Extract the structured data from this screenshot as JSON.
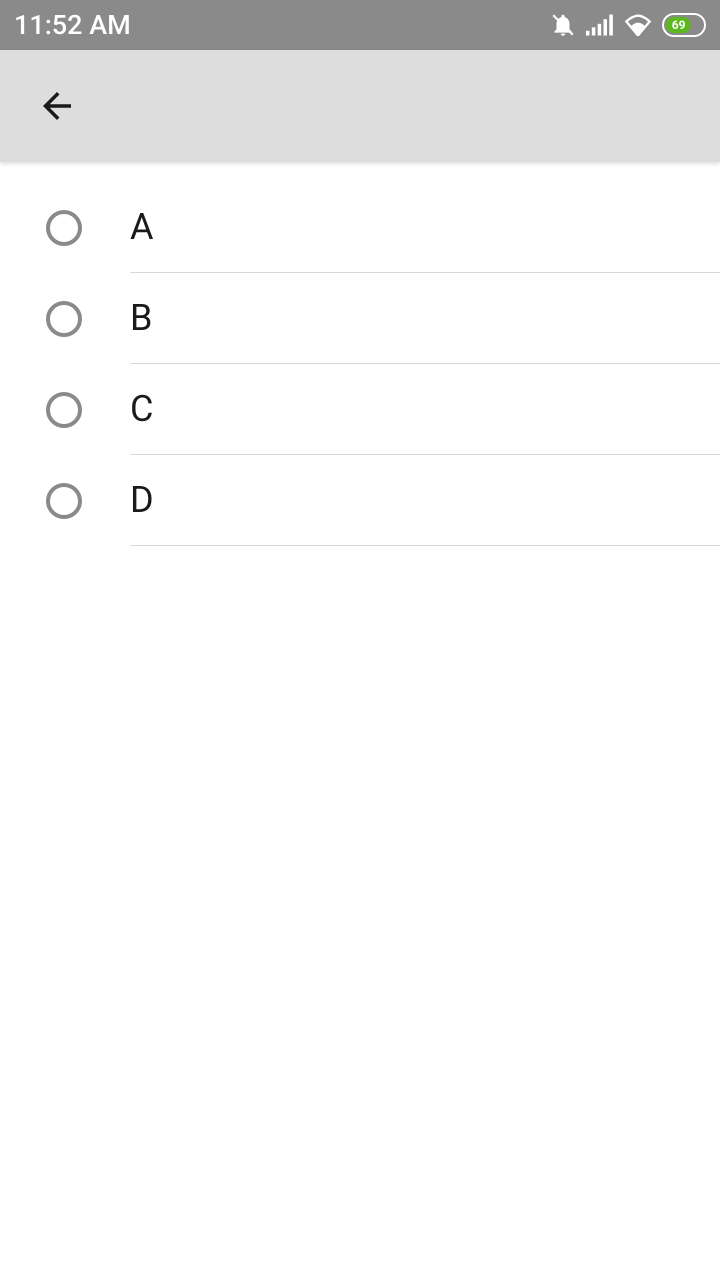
{
  "status_bar": {
    "time": "11:52 AM",
    "battery_level": "69",
    "icons": {
      "bell": "notifications-off-icon",
      "signal": "cellular-signal-icon",
      "wifi": "wifi-icon"
    }
  },
  "app_bar": {
    "back": "back"
  },
  "options": [
    {
      "label": "A",
      "selected": false
    },
    {
      "label": "B",
      "selected": false
    },
    {
      "label": "C",
      "selected": false
    },
    {
      "label": "D",
      "selected": false
    }
  ]
}
